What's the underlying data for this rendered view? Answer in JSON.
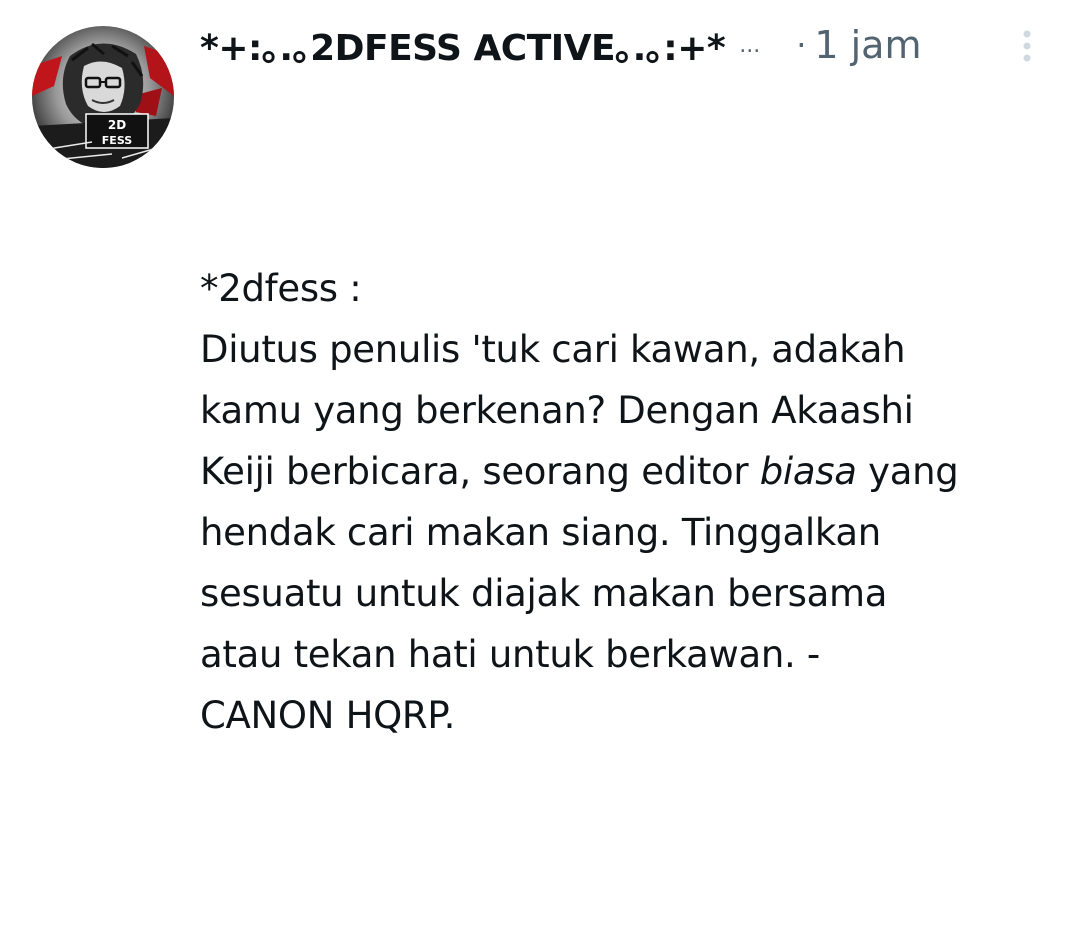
{
  "tweet": {
    "display_name": "*+:｡.｡2DFESS ACTIVE｡.｡:+*",
    "truncation": "...",
    "separator": "·",
    "timestamp": "1 jam",
    "avatar_text": "2D FESS",
    "body_lines": [
      {
        "text": "*2dfess :"
      },
      {
        "text": "Diutus penulis 'tuk cari kawan, adakah"
      },
      {
        "text": "kamu yang berkenan? Dengan Akaashi"
      },
      {
        "pre": "Keiji berbicara, seorang editor ",
        "em": "biasa",
        "post": " yang"
      },
      {
        "text": "hendak cari makan siang. Tinggalkan"
      },
      {
        "text": "sesuatu untuk diajak makan bersama"
      },
      {
        "text": "atau tekan hati untuk berkawan. -"
      },
      {
        "text": "CANON HQRP."
      }
    ]
  },
  "icons": {
    "more": "more-vertical-icon",
    "avatar": "avatar-image"
  },
  "colors": {
    "text_primary": "#0f1419",
    "text_secondary": "#536471",
    "more_icon": "#cfd9de",
    "background": "#ffffff"
  }
}
